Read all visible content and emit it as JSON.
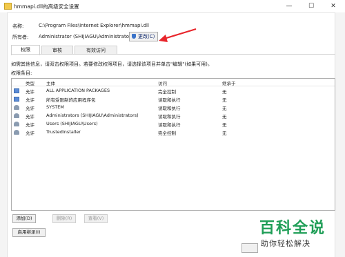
{
  "window": {
    "title": "hmmapi.dll的高级安全设置",
    "minimize": "—",
    "maximize": "☐",
    "close": "✕"
  },
  "info": {
    "name_label": "名称:",
    "name_value": "C:\\Program Files\\Internet Explorer\\hmmapi.dll",
    "owner_label": "所有者:",
    "owner_value": "Administrator (SHIJIAGU\\Administrator)",
    "change_button": "更改(C)"
  },
  "tabs": [
    {
      "label": "权限"
    },
    {
      "label": "审核"
    },
    {
      "label": "有效访问"
    }
  ],
  "hint_text": "如需其他信息，请双击权限项目。若要修改权限项目，请选择该项目并单击\"编辑\"(如果可用)。",
  "entries_label": "权限条目:",
  "table": {
    "headers": [
      "类型",
      "主体",
      "访问",
      "继承于"
    ],
    "rows": [
      {
        "icon": "package-icon",
        "type": "允许",
        "principal": "ALL APPLICATION PACKAGES",
        "access": "完全控制",
        "inherited": "无"
      },
      {
        "icon": "package-icon",
        "type": "允许",
        "principal": "所有受限制的应用程序包",
        "access": "读取和执行",
        "inherited": "无"
      },
      {
        "icon": "users-icon",
        "type": "允许",
        "principal": "SYSTEM",
        "access": "读取和执行",
        "inherited": "无"
      },
      {
        "icon": "users-icon",
        "type": "允许",
        "principal": "Administrators (SHIJIAGU\\Administrators)",
        "access": "读取和执行",
        "inherited": "无"
      },
      {
        "icon": "users-icon",
        "type": "允许",
        "principal": "Users (SHIJIAGU\\Users)",
        "access": "读取和执行",
        "inherited": "无"
      },
      {
        "icon": "users-icon",
        "type": "允许",
        "principal": "TrustedInstaller",
        "access": "完全控制",
        "inherited": "无"
      }
    ]
  },
  "buttons": {
    "add": "添加(D)",
    "remove": "删除(R)",
    "view": "查看(V)",
    "enable_inheritance": "启用继承(I)"
  },
  "watermark": {
    "big": "百科全说",
    "small": "助你轻松解决"
  },
  "colors": {
    "arrow": "#e8262c",
    "watermark": "#1f9e57"
  }
}
